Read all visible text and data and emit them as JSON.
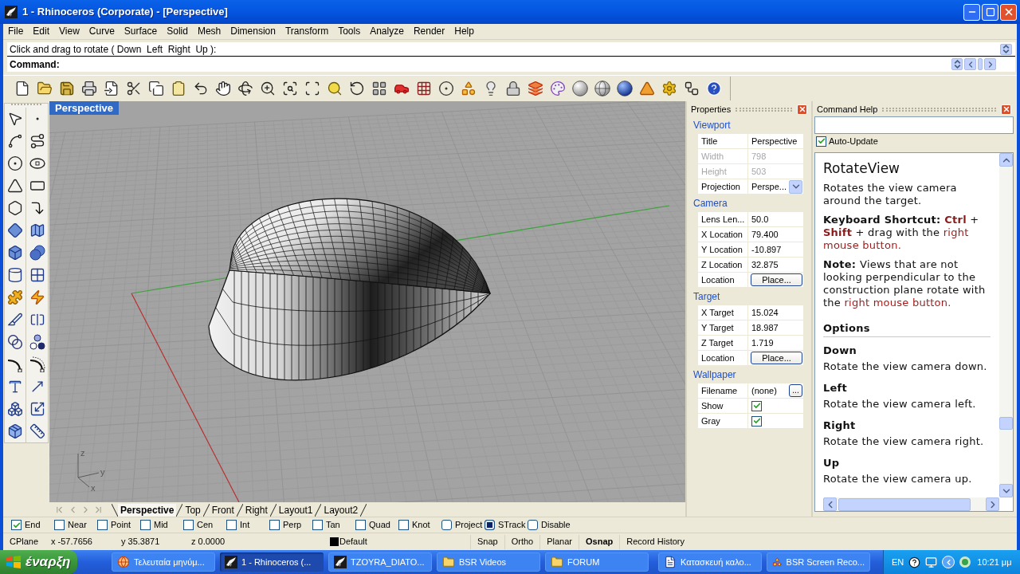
{
  "window": {
    "title": "1 - Rhinoceros (Corporate) - [Perspective]"
  },
  "menu": [
    "File",
    "Edit",
    "View",
    "Curve",
    "Surface",
    "Solid",
    "Mesh",
    "Dimension",
    "Transform",
    "Tools",
    "Analyze",
    "Render",
    "Help"
  ],
  "command_area": {
    "history": "Click and drag to rotate ( Down  Left  Right  Up ):",
    "prompt": "Command:"
  },
  "viewport": {
    "title": "Perspective",
    "gizmo_labels": [
      "z",
      "y",
      "x"
    ]
  },
  "viewport_tabs": [
    {
      "label": "Perspective",
      "selected": true
    },
    {
      "label": "Top",
      "selected": false
    },
    {
      "label": "Front",
      "selected": false
    },
    {
      "label": "Right",
      "selected": false
    },
    {
      "label": "Layout1",
      "selected": false
    },
    {
      "label": "Layout2",
      "selected": false
    }
  ],
  "properties": {
    "title": "Properties",
    "sections": [
      {
        "heading": "Viewport",
        "rows": [
          {
            "label": "Title",
            "kind": "text",
            "value": "Perspective",
            "disabled": false
          },
          {
            "label": "Width",
            "kind": "text",
            "value": "798",
            "disabled": true
          },
          {
            "label": "Height",
            "kind": "text",
            "value": "503",
            "disabled": true
          },
          {
            "label": "Projection",
            "kind": "dropdown",
            "value": "Perspe...",
            "disabled": false
          }
        ]
      },
      {
        "heading": "Camera",
        "rows": [
          {
            "label": "Lens Len...",
            "kind": "text",
            "value": "50.0",
            "disabled": false
          },
          {
            "label": "X Location",
            "kind": "text",
            "value": "79.400",
            "disabled": false
          },
          {
            "label": "Y Location",
            "kind": "text",
            "value": "-10.897",
            "disabled": false
          },
          {
            "label": "Z Location",
            "kind": "text",
            "value": "32.875",
            "disabled": false
          },
          {
            "label": "Location",
            "kind": "button",
            "button": "Place...",
            "disabled": false
          }
        ]
      },
      {
        "heading": "Target",
        "rows": [
          {
            "label": "X Target",
            "kind": "text",
            "value": "15.024",
            "disabled": false
          },
          {
            "label": "Y Target",
            "kind": "text",
            "value": "18.987",
            "disabled": false
          },
          {
            "label": "Z Target",
            "kind": "text",
            "value": "1.719",
            "disabled": false
          },
          {
            "label": "Location",
            "kind": "button",
            "button": "Place...",
            "disabled": false
          }
        ]
      },
      {
        "heading": "Wallpaper",
        "rows": [
          {
            "label": "Filename",
            "kind": "file",
            "value": "(none)",
            "button": "...",
            "disabled": false
          },
          {
            "label": "Show",
            "kind": "checkbox",
            "checked": true,
            "disabled": false
          },
          {
            "label": "Gray",
            "kind": "checkbox",
            "checked": true,
            "disabled": false
          }
        ]
      }
    ]
  },
  "command_help": {
    "title": "Command Help",
    "auto_update": {
      "label": "Auto-Update",
      "checked": true
    },
    "topic": {
      "title": "RotateView",
      "paragraphs": [
        {
          "segments": [
            {
              "kind": "plain",
              "text": "Rotates the view camera around the target."
            }
          ]
        },
        {
          "segments": [
            {
              "kind": "label",
              "text": "Keyboard Shortcut: "
            },
            {
              "kind": "key",
              "text": "Ctrl"
            },
            {
              "kind": "plain",
              "text": " + "
            },
            {
              "kind": "key",
              "text": "Shift"
            },
            {
              "kind": "plain",
              "text": " + drag with the "
            },
            {
              "kind": "term",
              "text": "right mouse button."
            }
          ]
        },
        {
          "segments": [
            {
              "kind": "label",
              "text": "Note: "
            },
            {
              "kind": "plain",
              "text": "Views that are not looking perpendicular to the construction plane rotate with the "
            },
            {
              "kind": "term",
              "text": "right mouse button."
            }
          ]
        }
      ],
      "options_heading": "Options",
      "options": [
        {
          "name": "Down",
          "description": "Rotate the view camera down."
        },
        {
          "name": "Left",
          "description": "Rotate the view camera left."
        },
        {
          "name": "Right",
          "description": "Rotate the view camera right."
        },
        {
          "name": "Up",
          "description": "Rotate the view camera up."
        }
      ]
    }
  },
  "osnaps": [
    {
      "label": "End",
      "kind": "check",
      "checked": true
    },
    {
      "label": "Near",
      "kind": "check",
      "checked": false
    },
    {
      "label": "Point",
      "kind": "check",
      "checked": false
    },
    {
      "label": "Mid",
      "kind": "check",
      "checked": false
    },
    {
      "label": "Cen",
      "kind": "check",
      "checked": false
    },
    {
      "label": "Int",
      "kind": "check",
      "checked": false
    },
    {
      "label": "Perp",
      "kind": "check",
      "checked": false
    },
    {
      "label": "Tan",
      "kind": "check",
      "checked": false
    },
    {
      "label": "Quad",
      "kind": "check",
      "checked": false
    },
    {
      "label": "Knot",
      "kind": "check",
      "checked": false
    },
    {
      "label": "Project",
      "kind": "toggle",
      "checked": false
    },
    {
      "label": "STrack",
      "kind": "toggle",
      "checked": true
    },
    {
      "label": "Disable",
      "kind": "toggle",
      "checked": false
    }
  ],
  "status_bar": {
    "cplane": "CPlane",
    "coordinates": [
      "x -57.7656",
      "y 35.3871",
      "z 0.0000"
    ],
    "layer": "Default",
    "toggles": [
      {
        "label": "Snap",
        "on": false
      },
      {
        "label": "Ortho",
        "on": false
      },
      {
        "label": "Planar",
        "on": false
      },
      {
        "label": "Osnap",
        "on": true
      },
      {
        "label": "Record History",
        "on": false
      }
    ]
  },
  "taskbar": {
    "start": "έναρξη",
    "items": [
      {
        "kind": "browser",
        "label": "Τελευταία μηνύμ...",
        "selected": false
      },
      {
        "kind": "app",
        "label": "1 - Rhinoceros (...",
        "selected": true
      },
      {
        "kind": "app",
        "label": "TZOYRA_DIATO...",
        "selected": false
      },
      {
        "kind": "folder",
        "label": "BSR Videos",
        "selected": false
      },
      {
        "kind": "folder",
        "label": "FORUM",
        "selected": false
      },
      {
        "kind": "document",
        "label": "Κατασκευή καλο...",
        "selected": false
      },
      {
        "kind": "recorder",
        "label": "BSR Screen Reco...",
        "selected": false
      }
    ],
    "language": "EN",
    "clock": "10:21 μμ"
  }
}
